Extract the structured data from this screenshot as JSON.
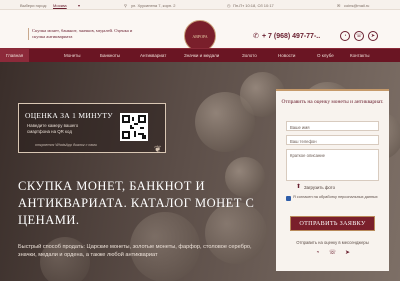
{
  "topbar": {
    "city_label": "Выбери город:",
    "city_value": "Москва",
    "address": "ул. Хуусинена 7, корп. 2",
    "hours": "Пн-Пт 10:18, Сб 10:17",
    "email": "coins@mail.ru"
  },
  "header": {
    "tagline": "Скупка монет, банкнот, значков, медалей. Оценка и скупка антиквариата",
    "logo_text": "АВРОРА",
    "phone": "+ 7 (968) 497-77-..",
    "icons": [
      "whatsapp-icon",
      "viber-icon",
      "telegram-icon"
    ]
  },
  "nav": {
    "items": [
      {
        "label": "Главная"
      },
      {
        "label": "Монеты"
      },
      {
        "label": "Банкноты"
      },
      {
        "label": "Антиквариат"
      },
      {
        "label": "Значки и медали"
      },
      {
        "label": "Золото"
      },
      {
        "label": "Новости"
      },
      {
        "label": "О клубе"
      },
      {
        "label": "Контакты"
      }
    ]
  },
  "qr": {
    "title": "ОЦЕНКА ЗА 1 МИНУТУ",
    "text": "Наведите камеру вашего смартфона на QR код",
    "note": "откроется WhatsApp диалог с нами"
  },
  "hero": {
    "title": "СКУПКА МОНЕТ, БАНКНОТ И АНТИКВАРИАТА. КАТАЛОГ МОНЕТ С ЦЕНАМИ.",
    "description": "Быстрый способ продать: Царские монеты, золотые монеты, фарфор, столовое серебро, значки, медали и ордена, а также любой антиквариат"
  },
  "form": {
    "title": "Отправить на оценку монеты и антиквариат.",
    "name_placeholder": "Ваше имя",
    "phone_placeholder": "Ваш телефон",
    "desc_placeholder": "Краткое описание",
    "upload_label": "Загрузить фото",
    "consent": "Я согласен на обработку персональных данных",
    "submit_label": "ОТПРАВИТЬ ЗАЯВКУ",
    "messenger_text": "Отправить на оценку в мессенджеры"
  },
  "colors": {
    "accent": "#6a1523",
    "brand": "#7a1f2b",
    "gold": "#c69a6a"
  }
}
